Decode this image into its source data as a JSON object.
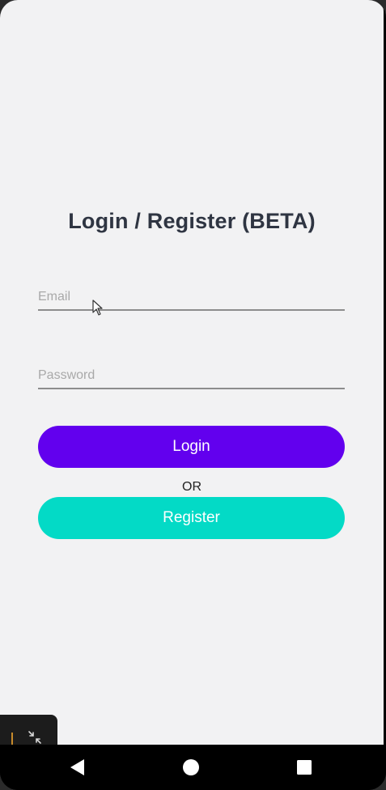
{
  "screen": {
    "title": "Login / Register (BETA)"
  },
  "form": {
    "email_placeholder": "Email",
    "email_value": "",
    "password_placeholder": "Password",
    "password_value": "",
    "login_label": "Login",
    "or_label": "OR",
    "register_label": "Register"
  },
  "colors": {
    "login_button": "#6200ee",
    "register_button": "#03dac6",
    "title_text": "#2f3542",
    "background": "#f2f2f3"
  },
  "system": {
    "nav_back_icon": "back-triangle-icon",
    "nav_home_icon": "home-circle-icon",
    "nav_recents_icon": "recents-square-icon",
    "floating_icon": "shrink-arrows-icon"
  }
}
